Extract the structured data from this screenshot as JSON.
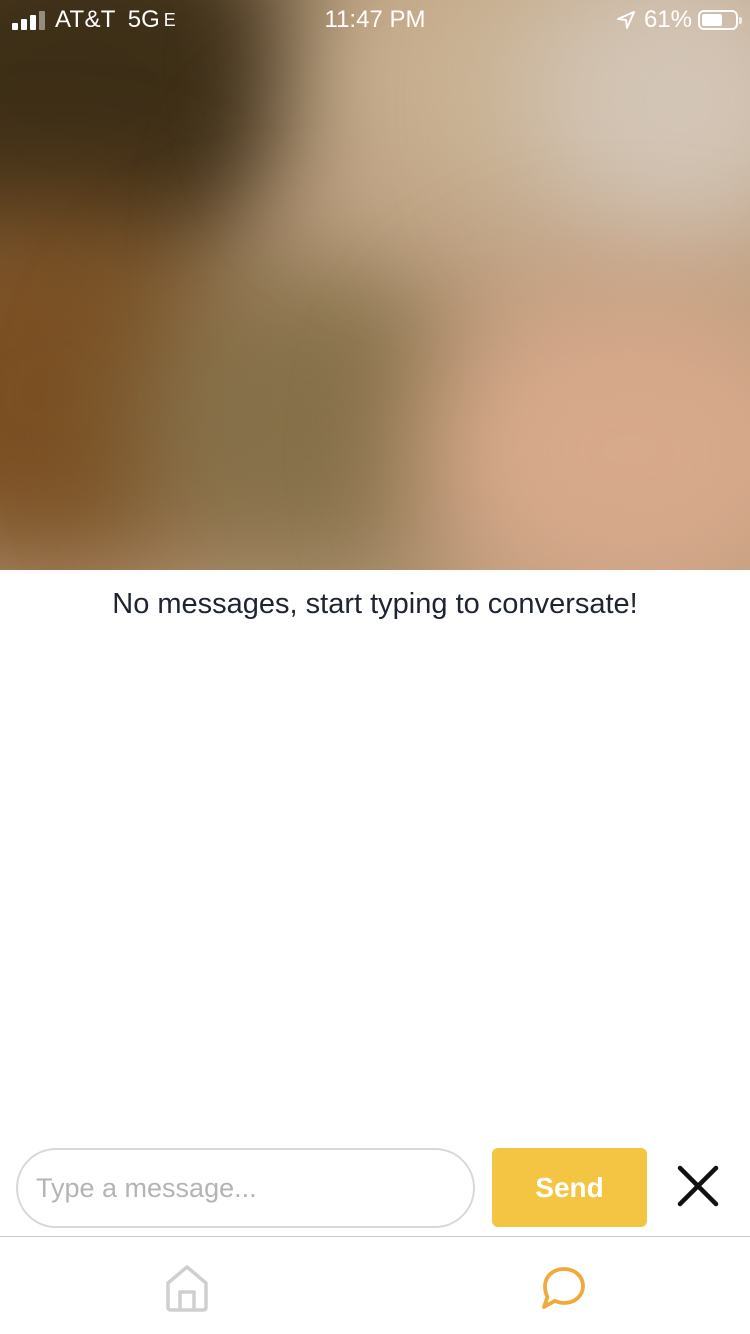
{
  "status_bar": {
    "carrier": "AT&T",
    "network": "5G",
    "network_suffix": "E",
    "time": "11:47 PM",
    "battery_percent": "61%",
    "battery_level": 0.61,
    "signal_bars": 3
  },
  "video": {
    "icon": "blurred-video-feed"
  },
  "conversation": {
    "empty_message": "No messages, start typing to conversate!"
  },
  "composer": {
    "input_value": "",
    "input_placeholder": "Type a message...",
    "send_label": "Send",
    "close_icon": "close-icon"
  },
  "tab_bar": {
    "tabs": [
      {
        "id": "home",
        "icon": "home-icon",
        "active": false
      },
      {
        "id": "chat",
        "icon": "chat-bubble-icon",
        "active": true
      }
    ]
  },
  "colors": {
    "accent": "#F4C542",
    "active_tab": "#F0A93B",
    "inactive_tab": "#CFCFCF",
    "text": "#1F2433"
  }
}
